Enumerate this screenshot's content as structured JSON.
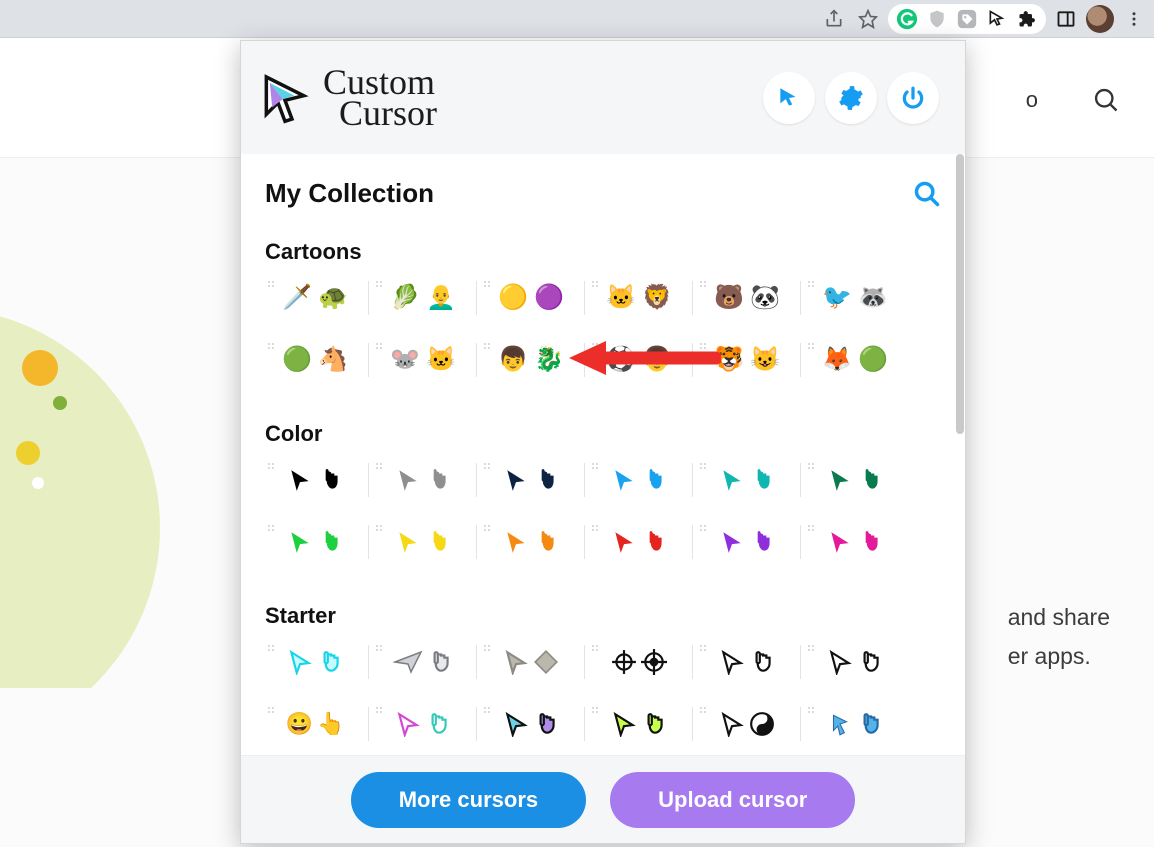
{
  "chrome": {
    "share_icon": "share-icon",
    "star_icon": "star-icon",
    "extensions": [
      "grammarly",
      "shield-gray",
      "shield-dark",
      "custom-cursor-active",
      "puzzle"
    ],
    "side_panel": "side-panel-icon",
    "menu_icon": "kebab-icon"
  },
  "second_bar": {
    "trailing_letter": "o",
    "search_icon": "search-icon"
  },
  "page_background": {
    "text_lines": [
      "and share",
      "er apps."
    ]
  },
  "popup": {
    "logo_text_top": "Custom",
    "logo_text_bottom": "Cursor",
    "header_buttons": [
      "cursor-icon",
      "gear-icon",
      "power-icon"
    ],
    "collection_title": "My Collection",
    "search_icon": "search-icon",
    "sections": [
      {
        "label": "Cartoons",
        "rows": [
          [
            {
              "a": "🗡️",
              "b": "🐢",
              "name": "tmnt"
            },
            {
              "a": "🥬",
              "b": "👨‍🦲",
              "name": "popeye"
            },
            {
              "a": "🟡",
              "b": "🟣",
              "name": "minion"
            },
            {
              "a": "🐱",
              "b": "🦁",
              "name": "felix"
            },
            {
              "a": "🐻",
              "b": "🐼",
              "name": "bears"
            },
            {
              "a": "🐦",
              "b": "🦝",
              "name": "regular-show"
            }
          ],
          [
            {
              "a": "🟢",
              "b": "🐴",
              "name": "shrek"
            },
            {
              "a": "🐭",
              "b": "🐱",
              "name": "tom-jerry"
            },
            {
              "a": "👦",
              "b": "🐉",
              "name": "httyd"
            },
            {
              "a": "⚽",
              "b": "👦",
              "name": "ben10"
            },
            {
              "a": "🐯",
              "b": "😺",
              "name": "garfield"
            },
            {
              "a": "🦊",
              "b": "🟢",
              "name": "grinch"
            }
          ]
        ]
      },
      {
        "label": "Color",
        "rows": [
          [
            {
              "c1": "#000000",
              "name": "black"
            },
            {
              "c1": "#8f8f8f",
              "name": "gray"
            },
            {
              "c1": "#0d2344",
              "name": "navy"
            },
            {
              "c1": "#1aa2f1",
              "name": "skyblue"
            },
            {
              "c1": "#10b7b0",
              "name": "teal"
            },
            {
              "c1": "#0a7a4f",
              "name": "darkgreen"
            }
          ],
          [
            {
              "c1": "#1ecf3e",
              "name": "green"
            },
            {
              "c1": "#f6d815",
              "name": "yellow"
            },
            {
              "c1": "#f58a13",
              "name": "orange"
            },
            {
              "c1": "#e5231f",
              "name": "red"
            },
            {
              "c1": "#8f2fdc",
              "name": "purple"
            },
            {
              "c1": "#e31b9a",
              "name": "magenta"
            }
          ]
        ]
      },
      {
        "label": "Starter",
        "rows": [
          [
            {
              "variant": "neon",
              "name": "neon-cyan"
            },
            {
              "variant": "paper",
              "name": "paper-plane"
            },
            {
              "variant": "stone",
              "name": "stone"
            },
            {
              "variant": "target",
              "name": "crosshair"
            },
            {
              "variant": "outline",
              "name": "outline-thick"
            },
            {
              "variant": "pixel",
              "name": "pixel"
            }
          ],
          [
            {
              "variant": "emoji-hand",
              "name": "emoji-yellow"
            },
            {
              "variant": "rainbow-outline",
              "name": "rainbow-outline"
            },
            {
              "variant": "prism",
              "name": "prism"
            },
            {
              "variant": "lime-outline",
              "name": "lime-outline"
            },
            {
              "variant": "yin",
              "name": "yin-yang"
            },
            {
              "variant": "pixel-blue",
              "name": "pixel-blue"
            }
          ]
        ]
      }
    ],
    "footer": {
      "more_label": "More cursors",
      "upload_label": "Upload cursor"
    }
  }
}
